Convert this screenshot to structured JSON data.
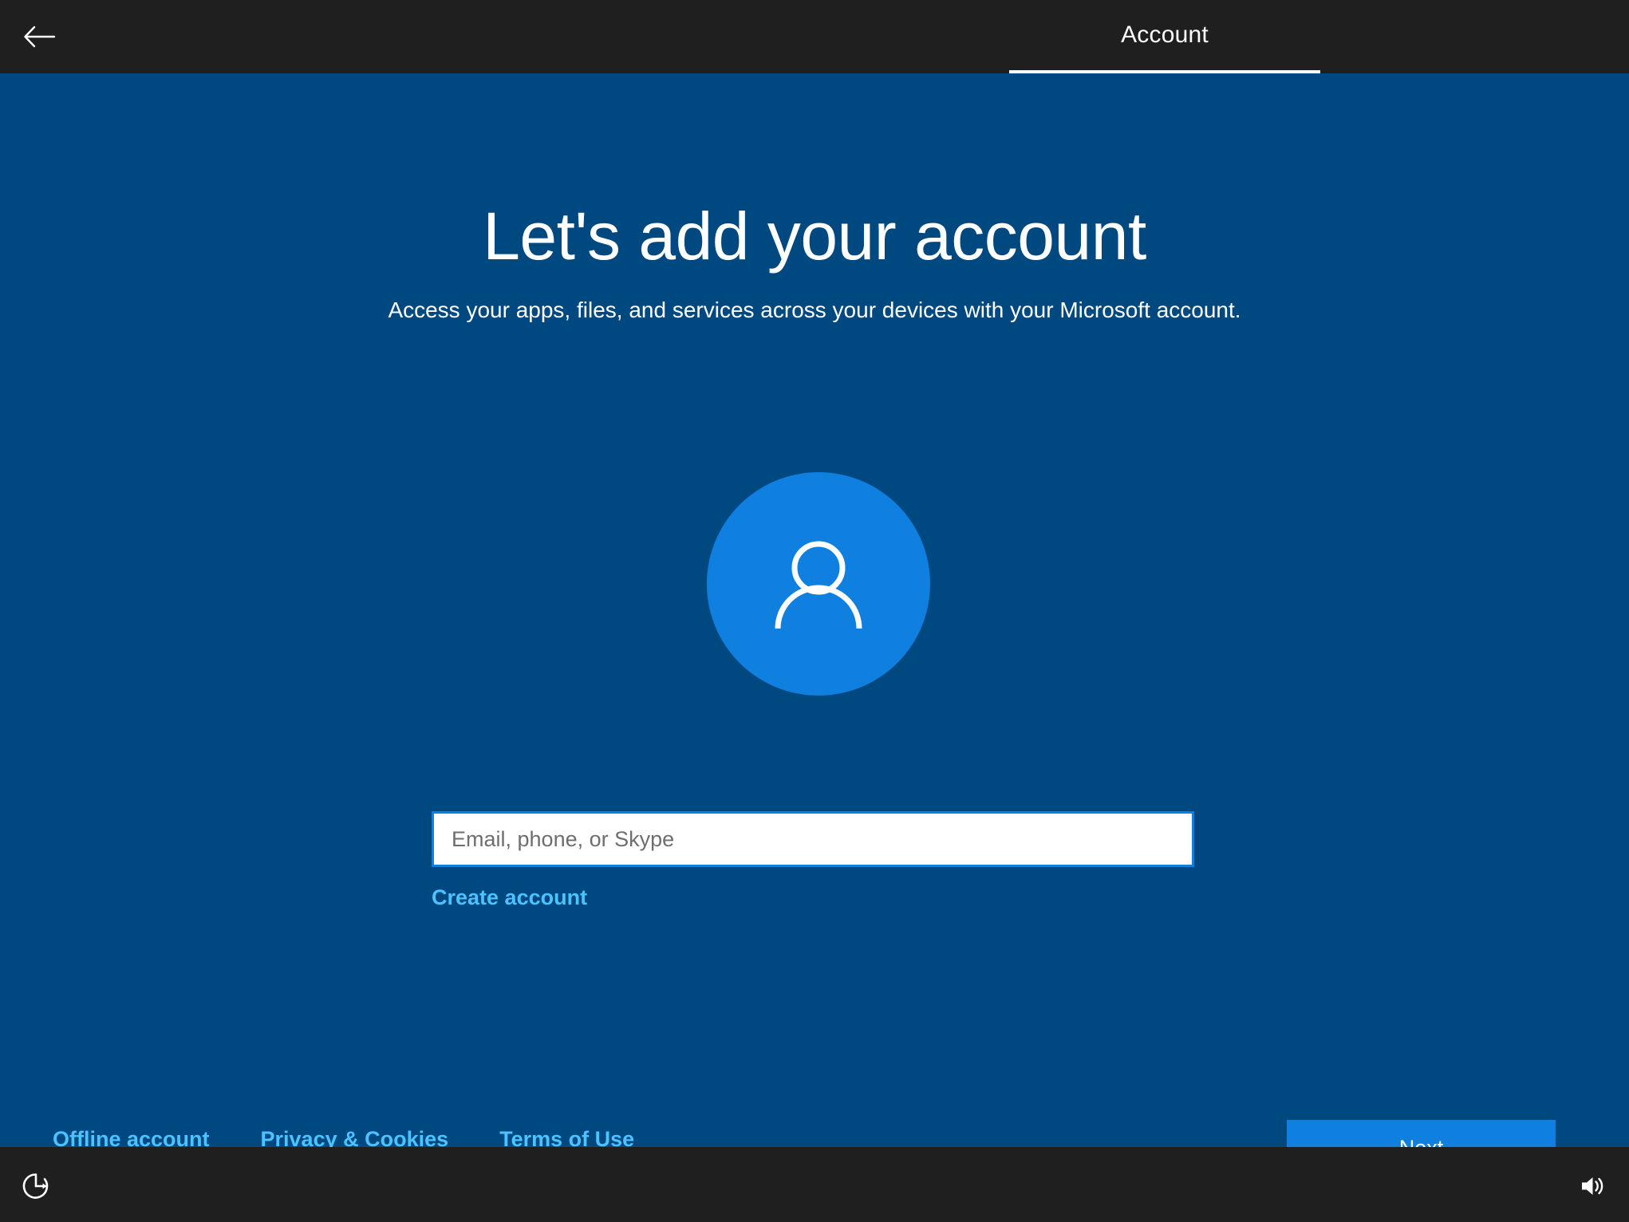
{
  "window": {
    "screen_name": "Windows OOBE Account Setup",
    "background_color": "#004880",
    "chrome_color": "#1f1f1f",
    "accent_color": "#0f80e0",
    "link_color": "#4cc2ff"
  },
  "header": {
    "back_icon": "back-arrow-icon",
    "tab_label": "Account",
    "tab_selected": true
  },
  "main": {
    "title": "Let's add your account",
    "subtitle": "Access your apps, files, and services across your devices with your Microsoft account.",
    "avatar_icon": "person-icon",
    "avatar_color": "#0f80e0",
    "account_input": {
      "value": "",
      "placeholder": "Email, phone, or Skype"
    },
    "create_account_label": "Create account"
  },
  "footer": {
    "links": [
      {
        "label": "Offline account"
      },
      {
        "label": "Privacy & Cookies"
      },
      {
        "label": "Terms of Use"
      }
    ],
    "next_label": "Next"
  },
  "taskbar": {
    "ease_of_access_icon": "ease-of-access-icon",
    "volume_icon": "volume-speaker-icon"
  }
}
